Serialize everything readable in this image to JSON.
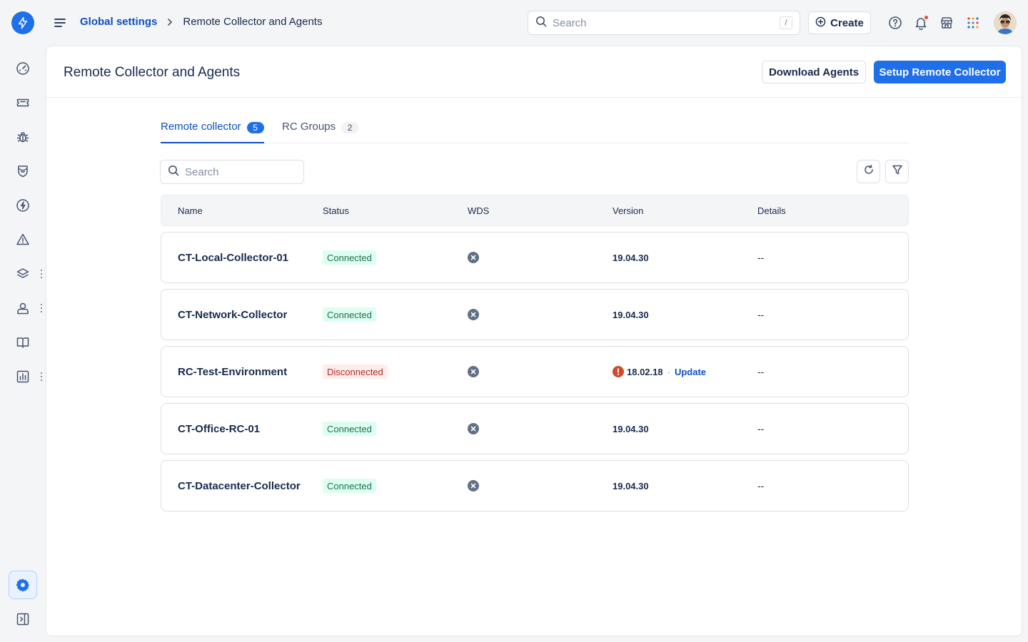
{
  "header": {
    "breadcrumb_parent": "Global settings",
    "breadcrumb_current": "Remote Collector and Agents",
    "search_placeholder": "Search",
    "search_shortcut": "/",
    "create_label": "Create"
  },
  "page": {
    "title": "Remote Collector and Agents",
    "download_label": "Download Agents",
    "setup_label": "Setup Remote Collector"
  },
  "tabs": [
    {
      "label": "Remote collector",
      "count": "5",
      "active": true
    },
    {
      "label": "RC Groups",
      "count": "2",
      "active": false
    }
  ],
  "list": {
    "search_placeholder": "Search",
    "columns": [
      "Name",
      "Status",
      "WDS",
      "Version",
      "Details"
    ],
    "rows": [
      {
        "name": "CT-Local-Collector-01",
        "status": "Connected",
        "version": "19.04.30",
        "details": "--"
      },
      {
        "name": "CT-Network-Collector",
        "status": "Connected",
        "version": "19.04.30",
        "details": "--"
      },
      {
        "name": "RC-Test-Environment",
        "status": "Disconnected",
        "version": "18.02.18",
        "update": "Update",
        "details": "--"
      },
      {
        "name": "CT-Office-RC-01",
        "status": "Connected",
        "version": "19.04.30",
        "details": "--"
      },
      {
        "name": "CT-Datacenter-Collector",
        "status": "Connected",
        "version": "19.04.30",
        "details": "--"
      }
    ]
  },
  "colors": {
    "accent": "#1f6feb",
    "link": "#0c4fc4",
    "success_bg": "#dcfff1",
    "danger_bg": "#ffeceb",
    "warning": "#d04a2c"
  }
}
